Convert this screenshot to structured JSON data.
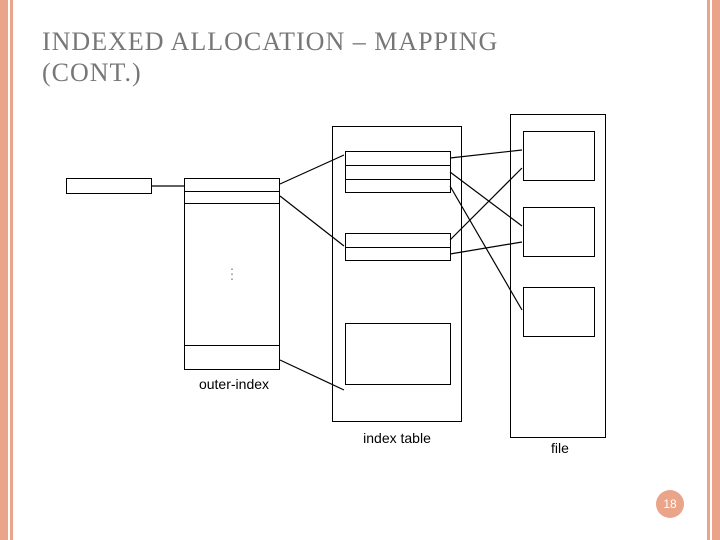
{
  "title_line1": "INDEXED ALLOCATION – MAPPING",
  "title_line2": "(CONT.)",
  "labels": {
    "outer_index": "outer-index",
    "index_table": "index table",
    "file": "file"
  },
  "slide_number": "18",
  "vdots": "⋮"
}
